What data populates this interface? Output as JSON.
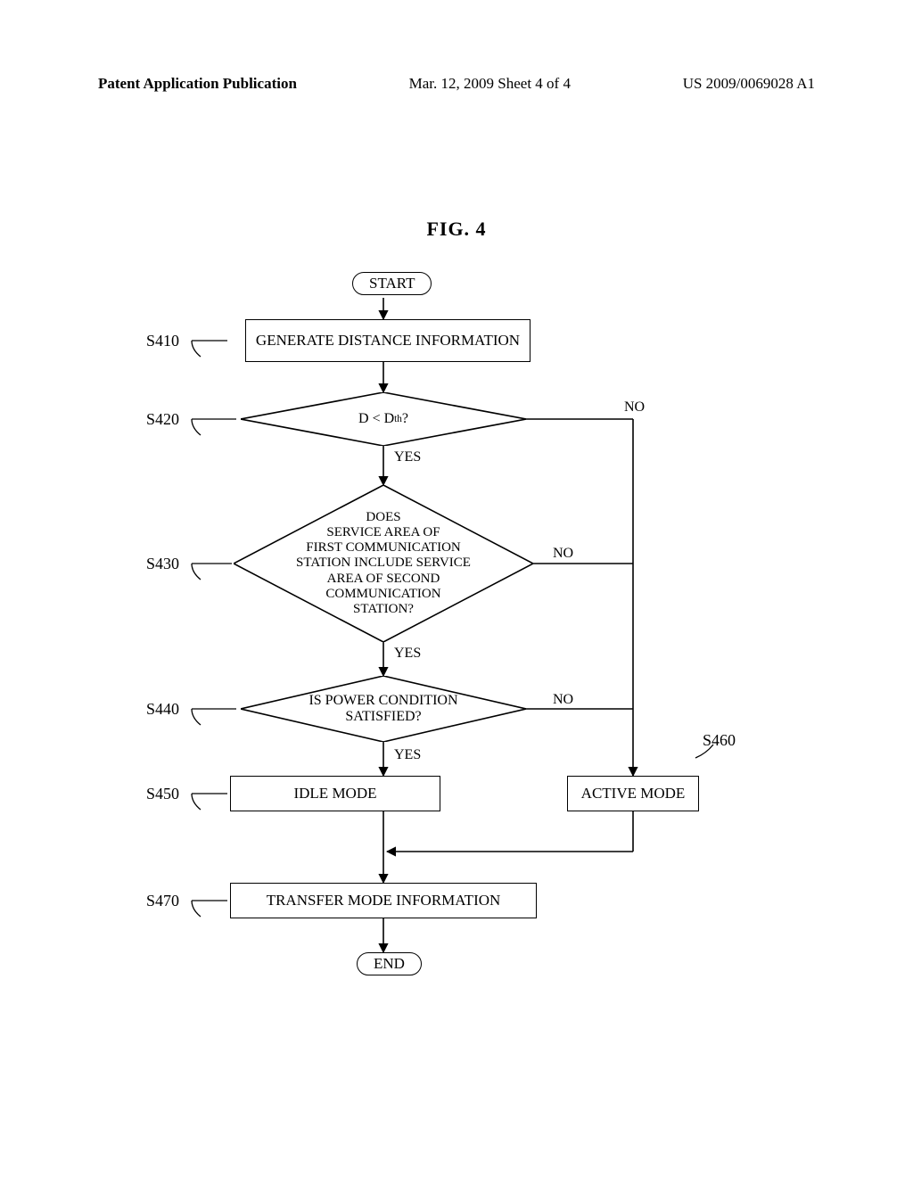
{
  "header": {
    "left_plain": "Patent Application Publication",
    "center": "Mar. 12, 2009  Sheet 4 of 4",
    "right": "US 2009/0069028 A1"
  },
  "figure_title": "FIG. 4",
  "terminals": {
    "start": "START",
    "end": "END"
  },
  "steps": {
    "s410": {
      "ref": "S410",
      "text": "GENERATE DISTANCE INFORMATION"
    },
    "s420": {
      "ref": "S420",
      "text_html": "D < D<sub>th</sub> ?"
    },
    "s430": {
      "ref": "S430",
      "text": "DOES SERVICE AREA OF FIRST COMMUNICATION STATION INCLUDE SERVICE AREA OF SECOND COMMUNICATION STATION?"
    },
    "s440": {
      "ref": "S440",
      "text": "IS POWER CONDITION SATISFIED?"
    },
    "s450": {
      "ref": "S450",
      "text": "IDLE MODE"
    },
    "s460": {
      "ref": "S460",
      "text": "ACTIVE MODE"
    },
    "s470": {
      "ref": "S470",
      "text": "TRANSFER MODE INFORMATION"
    }
  },
  "edge_labels": {
    "yes": "YES",
    "no": "NO"
  },
  "chart_data": {
    "type": "flowchart",
    "title": "FIG. 4",
    "nodes": [
      {
        "id": "start",
        "type": "terminal",
        "label": "START"
      },
      {
        "id": "S410",
        "type": "process",
        "label": "GENERATE DISTANCE INFORMATION"
      },
      {
        "id": "S420",
        "type": "decision",
        "label": "D < Dth ?"
      },
      {
        "id": "S430",
        "type": "decision",
        "label": "DOES SERVICE AREA OF FIRST COMMUNICATION STATION INCLUDE SERVICE AREA OF SECOND COMMUNICATION STATION?"
      },
      {
        "id": "S440",
        "type": "decision",
        "label": "IS POWER CONDITION SATISFIED?"
      },
      {
        "id": "S450",
        "type": "process",
        "label": "IDLE MODE"
      },
      {
        "id": "S460",
        "type": "process",
        "label": "ACTIVE MODE"
      },
      {
        "id": "S470",
        "type": "process",
        "label": "TRANSFER MODE INFORMATION"
      },
      {
        "id": "end",
        "type": "terminal",
        "label": "END"
      }
    ],
    "edges": [
      {
        "from": "start",
        "to": "S410"
      },
      {
        "from": "S410",
        "to": "S420"
      },
      {
        "from": "S420",
        "to": "S430",
        "label": "YES"
      },
      {
        "from": "S420",
        "to": "S460",
        "label": "NO"
      },
      {
        "from": "S430",
        "to": "S440",
        "label": "YES"
      },
      {
        "from": "S430",
        "to": "S460",
        "label": "NO"
      },
      {
        "from": "S440",
        "to": "S450",
        "label": "YES"
      },
      {
        "from": "S440",
        "to": "S460",
        "label": "NO"
      },
      {
        "from": "S450",
        "to": "S470"
      },
      {
        "from": "S460",
        "to": "S470"
      },
      {
        "from": "S470",
        "to": "end"
      }
    ]
  }
}
